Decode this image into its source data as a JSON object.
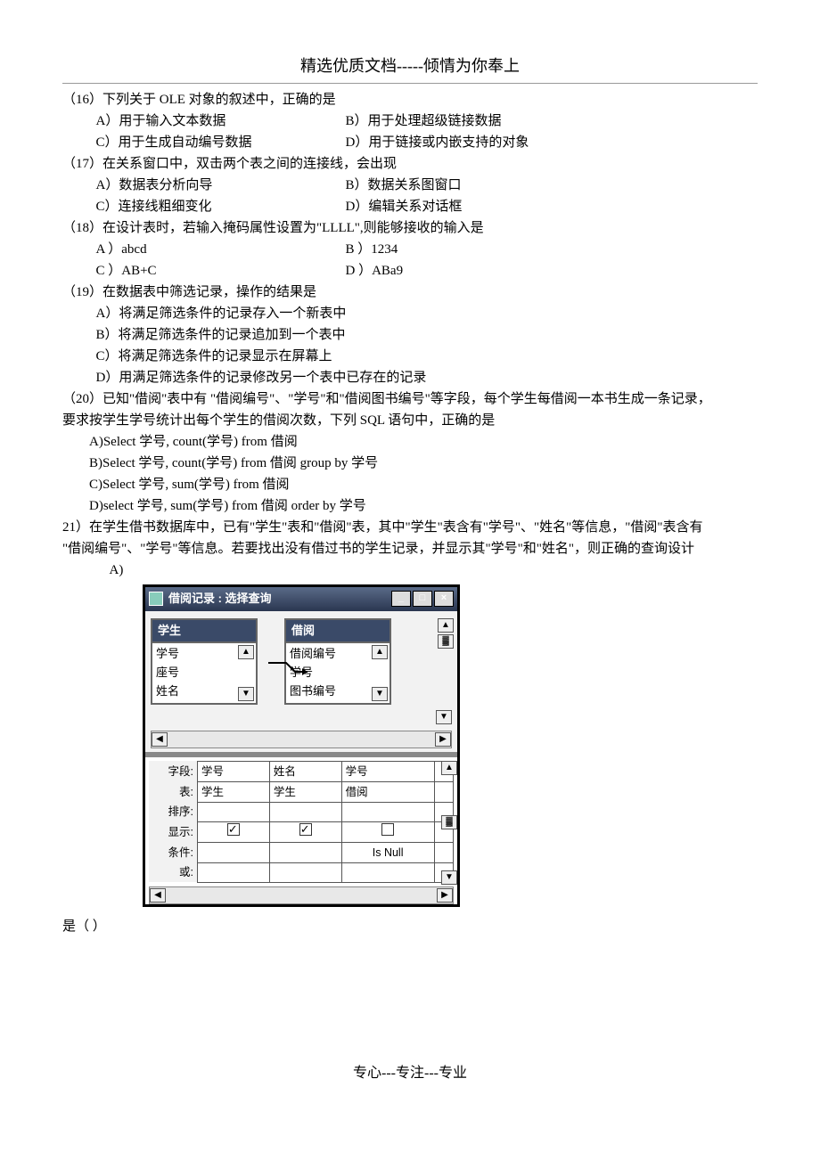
{
  "header": "精选优质文档-----倾情为你奉上",
  "q16": {
    "stem": "（16）下列关于 OLE 对象的叙述中，正确的是",
    "a": "A）用于输入文本数据",
    "b": "B）用于处理超级链接数据",
    "c": "C）用于生成自动编号数据",
    "d": "D）用于链接或内嵌支持的对象"
  },
  "q17": {
    "stem": "（17）在关系窗口中，双击两个表之间的连接线，会出现",
    "a": "A）数据表分析向导",
    "b": "B）数据关系图窗口",
    "c": "C）连接线粗细变化",
    "d": "D）编辑关系对话框"
  },
  "q18": {
    "stem": "（18）在设计表时，若输入掩码属性设置为\"LLLL\",则能够接收的输入是",
    "a": "A ）abcd",
    "b": "B ）1234",
    "c": "C ）AB+C",
    "d": "D ）ABa9"
  },
  "q19": {
    "stem": "（19）在数据表中筛选记录，操作的结果是",
    "a": "A）将满足筛选条件的记录存入一个新表中",
    "b": "B）将满足筛选条件的记录追加到一个表中",
    "c": "C）将满足筛选条件的记录显示在屏幕上",
    "d": "D）用满足筛选条件的记录修改另一个表中已存在的记录"
  },
  "q20": {
    "stem1": "（20）已知\"借阅\"表中有 \"借阅编号\"、\"学号\"和\"借阅图书编号\"等字段，每个学生每借阅一本书生成一条记录，",
    "stem2": "要求按学生学号统计出每个学生的借阅次数，下列 SQL 语句中，正确的是",
    "a": "A)Select  学号, count(学号) from  借阅",
    "b": "B)Select  学号, count(学号) from  借阅  group by  学号",
    "c": "C)Select  学号, sum(学号) from  借阅",
    "d": "D)select  学号, sum(学号) from  借阅  order by  学号"
  },
  "q21": {
    "stem1": "21）在学生借书数据库中，已有\"学生\"表和\"借阅\"表，其中\"学生\"表含有\"学号\"、\"姓名\"等信息，\"借阅\"表含有",
    "stem2": "\"借阅编号\"、\"学号\"等信息。若要找出没有借过书的学生记录，并显示其\"学号\"和\"姓名\"，则正确的查询设计",
    "a": "A)",
    "trail": "是（   ）"
  },
  "figure": {
    "title": "借阅记录  :  选择查询",
    "t1_name": "学生",
    "t1_f1": "学号",
    "t1_f2": "座号",
    "t1_f3": "姓名",
    "t2_name": "借阅",
    "t2_f1": "借阅编号",
    "t2_f2": "学号",
    "t2_f3": "图书编号",
    "row_field": "字段:",
    "row_table": "表:",
    "row_sort": "排序:",
    "row_show": "显示:",
    "row_cond": "条件:",
    "row_or": "或:",
    "c1_field": "学号",
    "c1_table": "学生",
    "c2_field": "姓名",
    "c2_table": "学生",
    "c3_field": "学号",
    "c3_table": "借阅",
    "c3_cond": "Is Null"
  },
  "footer": "专心---专注---专业"
}
